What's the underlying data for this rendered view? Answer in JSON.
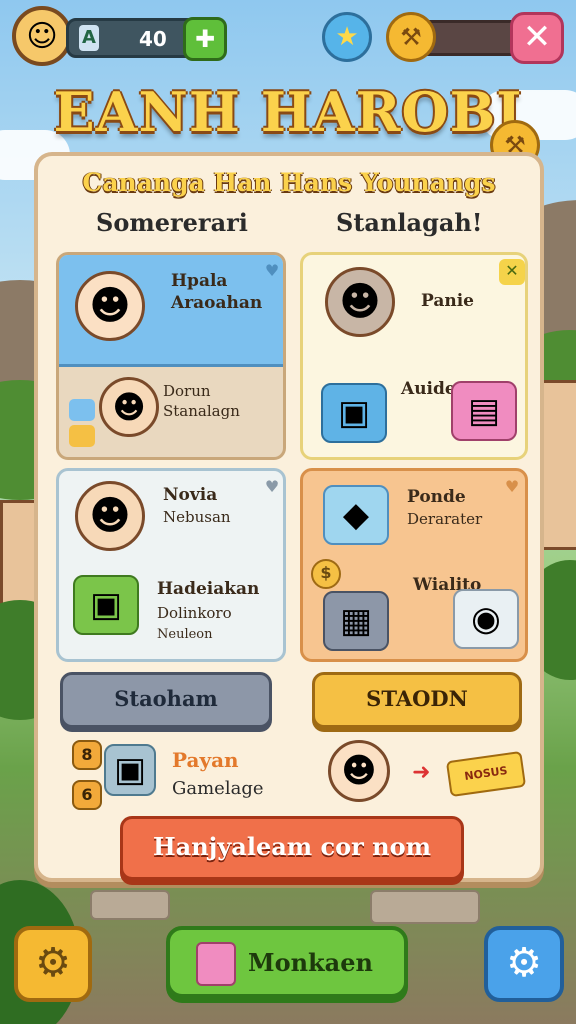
{
  "hud": {
    "coins": "40",
    "coin_pin": "A",
    "add_icon": "plus-icon",
    "gem_icon": "gem-icon",
    "energy_icon": "wrench-icon",
    "close_icon": "close-icon"
  },
  "title": "EANH HAROBI",
  "panel": {
    "subtitle": "Cananga Han Hans Younangs",
    "left_label": "Somererari",
    "right_label": "Stanlagah!",
    "cards": [
      {
        "line1": "Hpala",
        "line2": "Araoahan",
        "sub1": "Dorun",
        "sub2": "Stanalagn"
      },
      {
        "line1": "Panie",
        "line2": "Auide"
      },
      {
        "line1": "Novia",
        "line2": "Nebusan",
        "sub1": "Hadeiakan",
        "sub2": "Dolinkoro",
        "sub3": "Neuleon"
      },
      {
        "line1": "Ponde",
        "line2": "Derarater",
        "sub1": "Wialito"
      }
    ],
    "buttons": {
      "left": "Staoham",
      "right": "STAODN"
    },
    "rewards": {
      "num1": "8",
      "num2": "6",
      "title": "Payan",
      "desc": "Gamelage",
      "tag": "NOSUS"
    },
    "main_button": "Hanjyaleam cor nom"
  },
  "bottom": {
    "main_label": "Monkaen",
    "left_icon": "settings-icon",
    "right_icon": "settings-icon"
  }
}
